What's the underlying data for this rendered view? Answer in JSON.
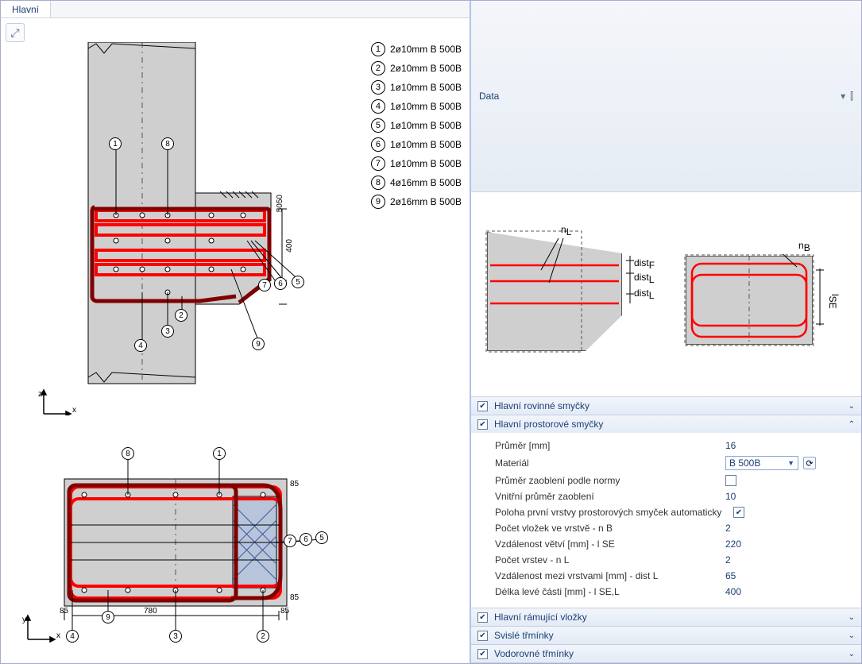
{
  "leftPanel": {
    "tab": "Hlavní",
    "legend": [
      {
        "n": "1",
        "txt": "2ø10mm B 500B"
      },
      {
        "n": "2",
        "txt": "2ø10mm B 500B"
      },
      {
        "n": "3",
        "txt": "1ø10mm B 500B"
      },
      {
        "n": "4",
        "txt": "1ø10mm B 500B"
      },
      {
        "n": "5",
        "txt": "1ø10mm B 500B"
      },
      {
        "n": "6",
        "txt": "1ø10mm B 500B"
      },
      {
        "n": "7",
        "txt": "1ø10mm B 500B"
      },
      {
        "n": "8",
        "txt": "4ø16mm B 500B"
      },
      {
        "n": "9",
        "txt": "2ø16mm B 500B"
      }
    ],
    "axes": {
      "fig1v": "z",
      "fig1h": "x",
      "fig2v": "y",
      "fig2h": "x"
    },
    "dims": {
      "d400": "400",
      "d5050": "5050",
      "d780": "780",
      "b1": "85",
      "b2": "85",
      "b3": "85",
      "b4": "85"
    }
  },
  "rightPanel": {
    "title": "Data",
    "pin": "⇩",
    "pin2": "ᴓ",
    "diagramLabels": {
      "nL": "n",
      "nLsub": "L",
      "nB": "n",
      "nBsub": "B",
      "distF": "dist",
      "distFsub": "F",
      "distL1": "dist",
      "distL1sub": "L",
      "distL2": "dist",
      "distL2sub": "L",
      "lse": "l",
      "lsesub": "SE"
    },
    "sections": [
      {
        "title": "Hlavní rovinné smyčky",
        "checked": true,
        "open": false
      },
      {
        "title": "Hlavní prostorové smyčky",
        "checked": true,
        "open": true,
        "props": [
          {
            "label": "Průměr [mm]",
            "type": "text",
            "value": "16"
          },
          {
            "label": "Materiál",
            "type": "combo",
            "value": "B 500B"
          },
          {
            "label": "Průměr zaoblení podle normy",
            "type": "check",
            "value": false
          },
          {
            "label": "Vnitřní průměr zaoblení",
            "type": "text",
            "value": "10"
          },
          {
            "label": "Poloha první vrstvy prostorových smyček automaticky",
            "type": "check",
            "value": true
          },
          {
            "label": "Počet vložek ve vrstvě - n B",
            "type": "text",
            "value": "2"
          },
          {
            "label": "Vzdálenost větví [mm] - l SE",
            "type": "text",
            "value": "220"
          },
          {
            "label": "Počet vrstev - n L",
            "type": "text",
            "value": "2"
          },
          {
            "label": "Vzdálenost mezi vrstvami [mm] - dist L",
            "type": "text",
            "value": "65"
          },
          {
            "label": "Délka levé části [mm] - l SE,L",
            "type": "text",
            "value": "400"
          }
        ]
      },
      {
        "title": "Hlavní rámující vložky",
        "checked": true,
        "open": false
      },
      {
        "title": "Svislé třmínky",
        "checked": true,
        "open": false
      },
      {
        "title": "Vodorovné třmínky",
        "checked": true,
        "open": false
      }
    ]
  }
}
